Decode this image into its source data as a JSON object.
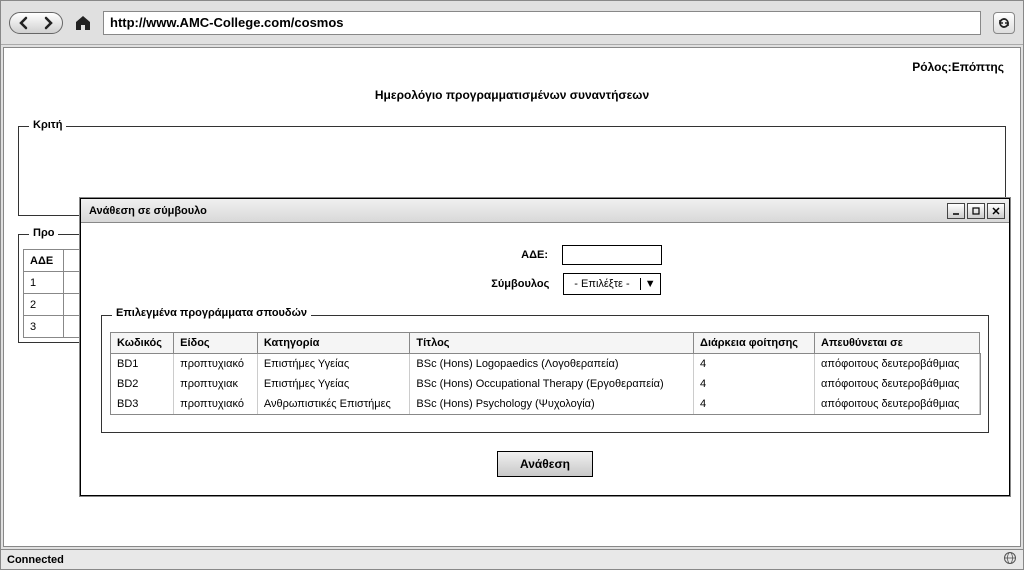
{
  "browser": {
    "url": "http://www.AMC-College.com/cosmos",
    "status": "Connected"
  },
  "page": {
    "role_label": "Ρόλος:",
    "role_value": "Επόπτης",
    "title": "Ημερολόγιο προγραμματισμένων συναντήσεων",
    "criteria_legend": "Κριτή",
    "list_legend": "Προ",
    "bg_col1": "ΑΔΕ",
    "bg_rows": [
      "1",
      "2",
      "3"
    ]
  },
  "dialog": {
    "title": "Ανάθεση σε σύμβουλο",
    "ade_label": "ΑΔΕ:",
    "ade_value": "",
    "consultant_label": "Σύμβουλος",
    "consultant_selected": "- Επιλέξτε -",
    "programs_legend": "Επιλεγμένα προγράμματα σπουδών",
    "columns": {
      "code": "Κωδικός",
      "kind": "Είδος",
      "category": "Κατηγορία",
      "title": "Τίτλος",
      "duration": "Διάρκεια φοίτησης",
      "target": "Απευθύνεται σε"
    },
    "rows": [
      {
        "code": "BD1",
        "kind": "προπτυχιακό",
        "category": "Επιστήμες Υγείας",
        "title": "BSc (Hons) Logopaedics (Λογοθεραπεία)",
        "duration": "4",
        "target": "απόφοιτους δευτεροβάθμιας"
      },
      {
        "code": "BD2",
        "kind": "προπτυχιακ",
        "category": "Επιστήμες Υγείας",
        "title": "BSc (Hons) Occupational Therapy (Εργοθεραπεία)",
        "duration": "4",
        "target": "απόφοιτους δευτεροβάθμιας"
      },
      {
        "code": "BD3",
        "kind": "προπτυχιακό",
        "category": "Ανθρωπιστικές Επιστήμες",
        "title": "BSc (Hons) Psychology (Ψυχολογία)",
        "duration": "4",
        "target": "απόφοιτους δευτεροβάθμιας"
      }
    ],
    "assign_button": "Ανάθεση"
  }
}
